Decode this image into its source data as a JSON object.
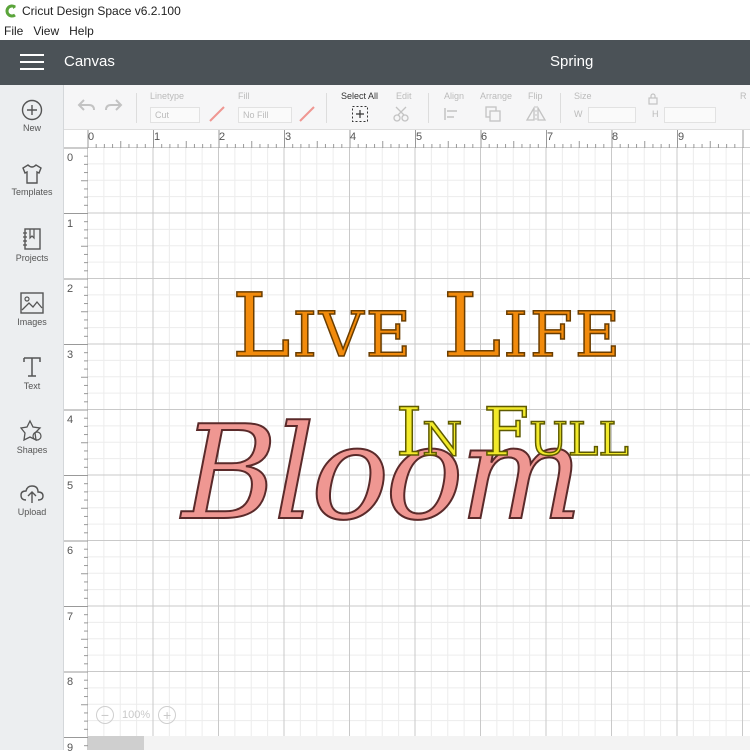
{
  "titlebar": {
    "title": "Cricut Design Space  v6.2.100"
  },
  "menu": [
    "File",
    "View",
    "Help"
  ],
  "appbar": {
    "section": "Canvas",
    "project": "Spring"
  },
  "sidebar": [
    {
      "label": "New",
      "icon": "plus-circle-icon"
    },
    {
      "label": "Templates",
      "icon": "tshirt-icon"
    },
    {
      "label": "Projects",
      "icon": "notebook-icon"
    },
    {
      "label": "Images",
      "icon": "image-icon"
    },
    {
      "label": "Text",
      "icon": "text-icon"
    },
    {
      "label": "Shapes",
      "icon": "shapes-icon"
    },
    {
      "label": "Upload",
      "icon": "upload-cloud-icon"
    }
  ],
  "toolbar": {
    "linetype_label": "Linetype",
    "linetype_value": "Cut",
    "fill_label": "Fill",
    "fill_value": "No Fill",
    "select_all": "Select All",
    "edit": "Edit",
    "align": "Align",
    "arrange": "Arrange",
    "flip": "Flip",
    "size": "Size",
    "w": "W",
    "h": "H",
    "r": "R"
  },
  "ruler": {
    "top": [
      "0",
      "1",
      "2",
      "3",
      "4",
      "5",
      "6",
      "7",
      "8",
      "9"
    ],
    "left": [
      "0",
      "1",
      "2",
      "3",
      "4",
      "5",
      "6",
      "7",
      "8",
      "9"
    ]
  },
  "design": {
    "line1": "Live Life",
    "line2": "In Full",
    "line3": "Bloom",
    "colors": {
      "line1": "#f28b0c",
      "line2": "#f2ea2a",
      "line3": "#ef9792"
    }
  },
  "zoom": {
    "level": "100%"
  }
}
